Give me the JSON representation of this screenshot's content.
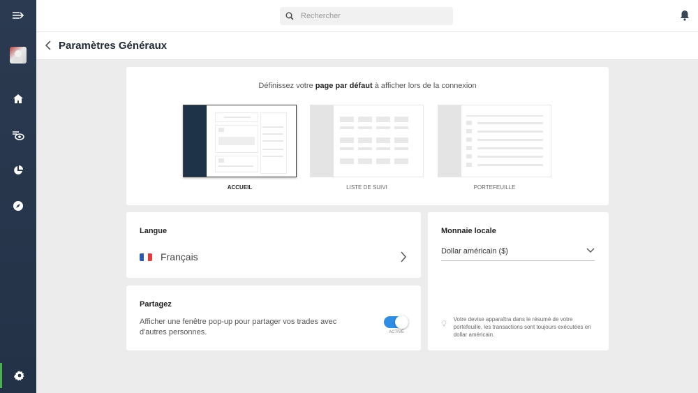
{
  "search": {
    "placeholder": "Rechercher"
  },
  "page": {
    "title": "Paramètres Généraux"
  },
  "default_page": {
    "text_before": "Définissez votre ",
    "text_bold": "page par défaut",
    "text_after": " à afficher lors de la connexion",
    "options": [
      {
        "label": "ACCUEIL",
        "selected": true
      },
      {
        "label": "LISTE DE SUIVI",
        "selected": false
      },
      {
        "label": "PORTEFEUILLE",
        "selected": false
      }
    ]
  },
  "language": {
    "heading": "Langue",
    "value": "Français",
    "flag_colors": [
      "#2e5aac",
      "#ffffff",
      "#e23b3b"
    ]
  },
  "share": {
    "heading": "Partagez",
    "description": "Afficher une fenêtre pop-up pour partager vos trades avec d'autres personnes.",
    "toggle_on": true,
    "toggle_label": "ACTIVÉ"
  },
  "currency": {
    "heading": "Monnaie locale",
    "value": "Dollar américain ($)",
    "hint": "Votre devise apparaîtra dans le résumé de votre portefeuille, les transactions sont toujours exécutées en dollar américain."
  },
  "colors": {
    "sidebar": "#2b3a50",
    "accent_active": "#4caf50",
    "toggle": "#2f8de4"
  }
}
